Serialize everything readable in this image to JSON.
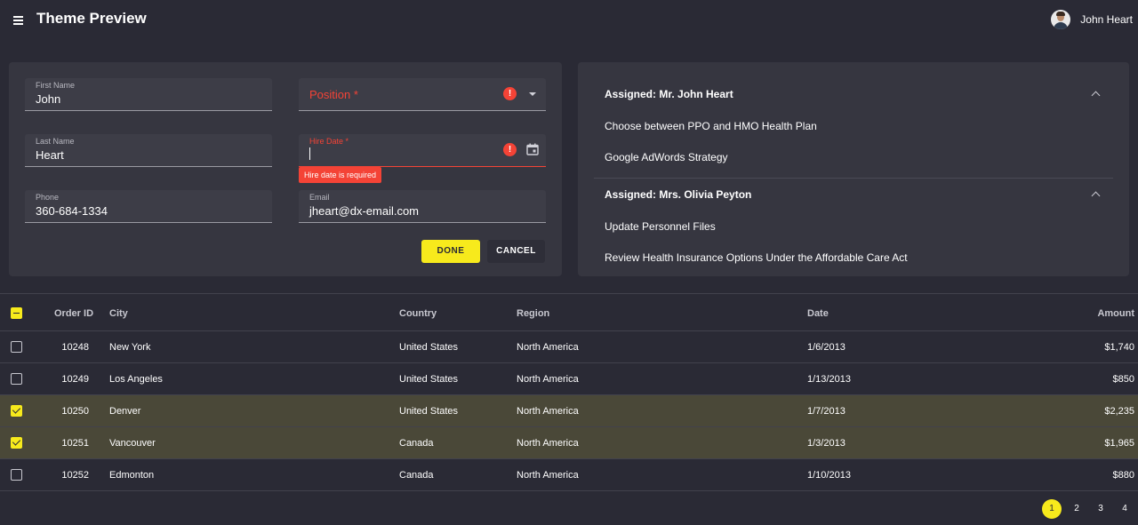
{
  "header": {
    "title": "Theme Preview",
    "user_name": "John Heart"
  },
  "form": {
    "first_name": {
      "label": "First Name",
      "value": "John"
    },
    "last_name": {
      "label": "Last Name",
      "value": "Heart"
    },
    "phone": {
      "label": "Phone",
      "value": "360-684-1334"
    },
    "position": {
      "placeholder": "Position *"
    },
    "hire_date": {
      "label": "Hire Date *",
      "value": "",
      "error": "Hire date is required"
    },
    "email": {
      "label": "Email",
      "value": "jheart@dx-email.com"
    },
    "done_label": "DONE",
    "cancel_label": "CANCEL"
  },
  "tasks": {
    "groups": [
      {
        "title": "Assigned: Mr. John Heart",
        "items": [
          "Choose between PPO and HMO Health Plan",
          "Google AdWords Strategy"
        ]
      },
      {
        "title": "Assigned: Mrs. Olivia Peyton",
        "items": [
          "Update Personnel Files",
          "Review Health Insurance Options Under the Affordable Care Act"
        ]
      }
    ]
  },
  "grid": {
    "columns": [
      "Order ID",
      "City",
      "Country",
      "Region",
      "Date",
      "Amount"
    ],
    "rows": [
      {
        "selected": false,
        "order_id": "10248",
        "city": "New York",
        "country": "United States",
        "region": "North America",
        "date": "1/6/2013",
        "amount": "$1,740"
      },
      {
        "selected": false,
        "order_id": "10249",
        "city": "Los Angeles",
        "country": "United States",
        "region": "North America",
        "date": "1/13/2013",
        "amount": "$850"
      },
      {
        "selected": true,
        "order_id": "10250",
        "city": "Denver",
        "country": "United States",
        "region": "North America",
        "date": "1/7/2013",
        "amount": "$2,235"
      },
      {
        "selected": true,
        "order_id": "10251",
        "city": "Vancouver",
        "country": "Canada",
        "region": "North America",
        "date": "1/3/2013",
        "amount": "$1,965"
      },
      {
        "selected": false,
        "order_id": "10252",
        "city": "Edmonton",
        "country": "Canada",
        "region": "North America",
        "date": "1/10/2013",
        "amount": "$880"
      }
    ],
    "pages": [
      "1",
      "2",
      "3",
      "4"
    ],
    "current_page": "1"
  },
  "colors": {
    "accent": "#f7ea1c",
    "error": "#f44336",
    "background": "#2a2a35",
    "surface": "#363640",
    "selected_row": "#4a4838"
  }
}
